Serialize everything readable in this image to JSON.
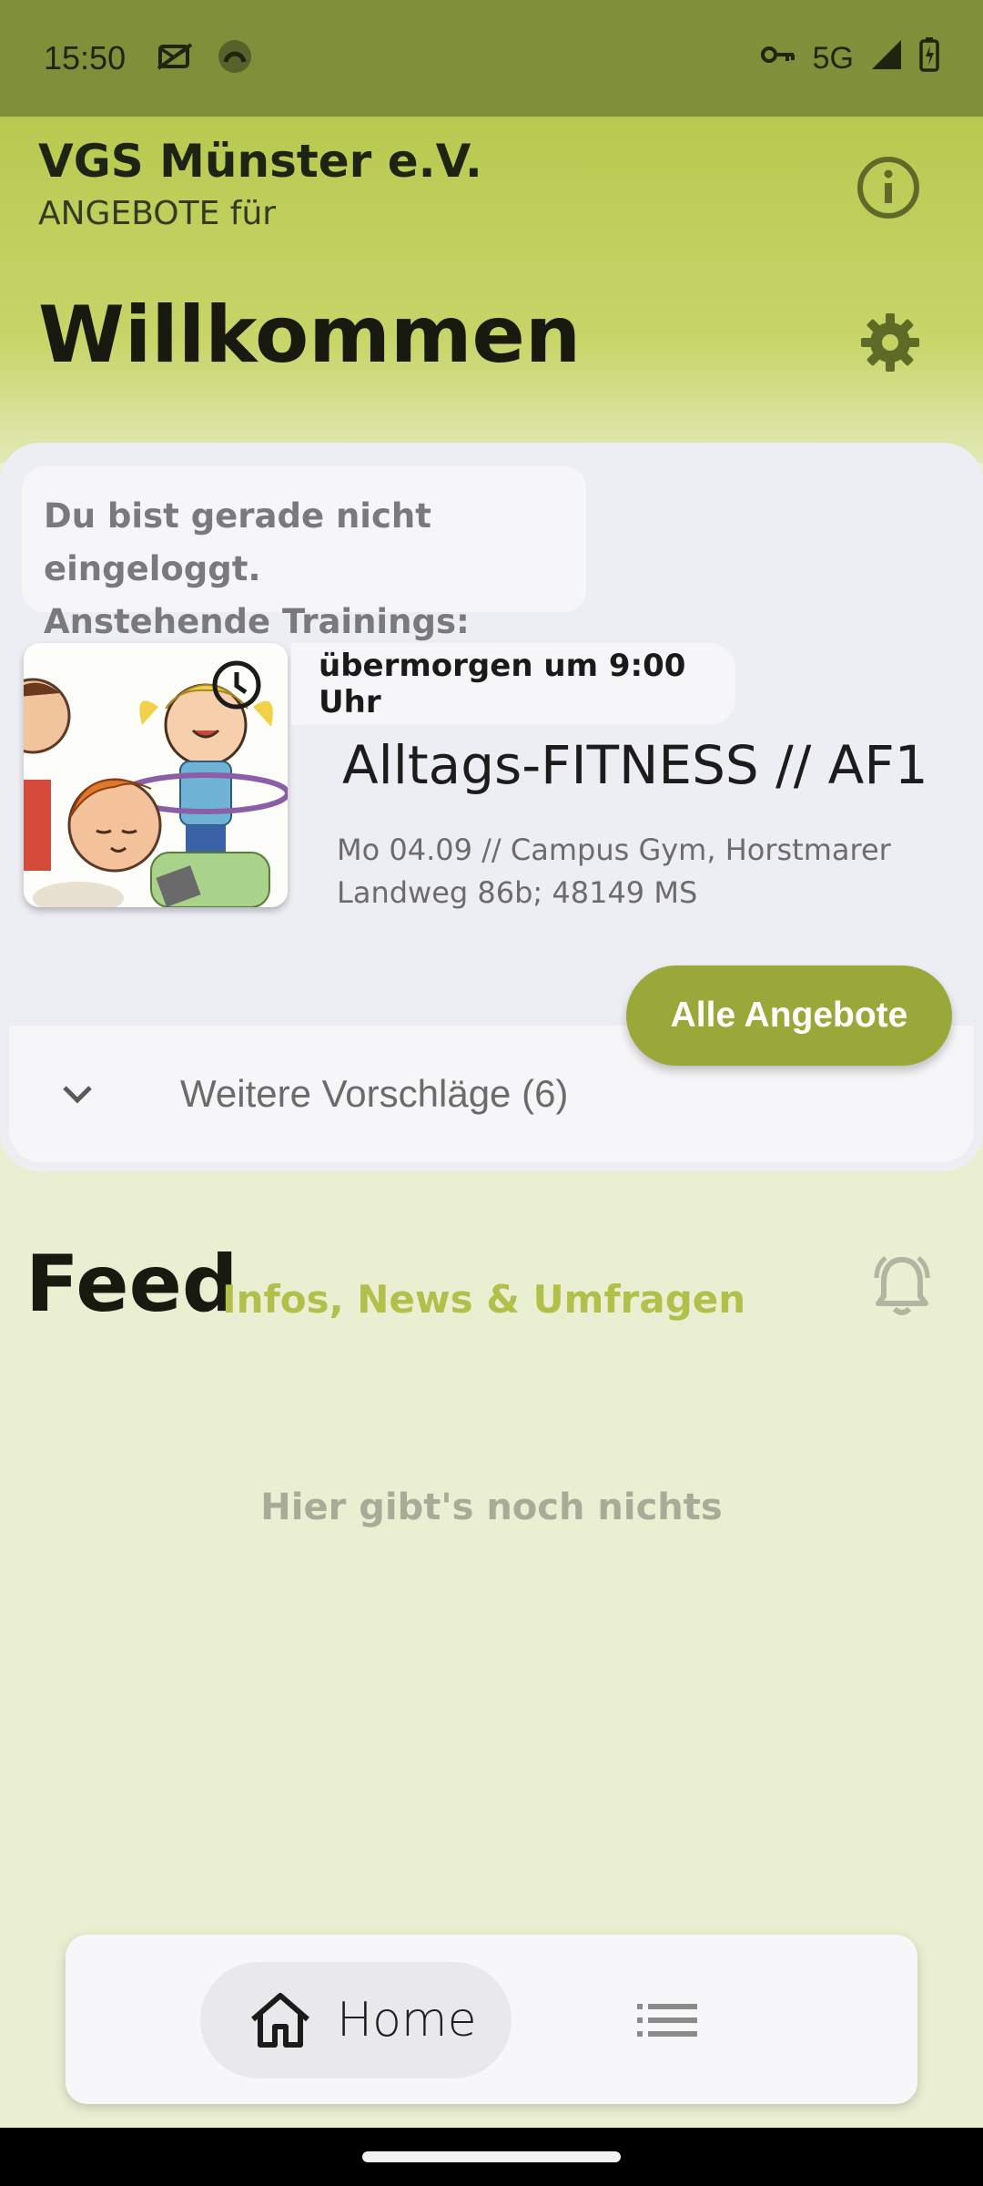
{
  "status_bar": {
    "time": "15:50",
    "network": "5G",
    "icons": [
      "mail-off-icon",
      "app-circle-icon",
      "vpn-key-icon",
      "signal-icon",
      "battery-icon"
    ]
  },
  "header": {
    "org_name": "VGS Münster e.V.",
    "subtitle": "ANGEBOTE für",
    "welcome": "Willkommen",
    "accent_color": "#b8c950"
  },
  "card": {
    "login_note_line1": "Du bist gerade nicht eingeloggt.",
    "login_note_line2": "Anstehende Trainings:",
    "training": {
      "when": "übermorgen um 9:00 Uhr",
      "title": "Alltags-FITNESS // AF1",
      "detail": "Mo 04.09 // Campus Gym, Horstmarer Landweg 86b; 48149 MS"
    },
    "all_offers_label": "Alle Angebote",
    "more_suggestions_label": "Weitere Vorschläge (6)"
  },
  "feed": {
    "title": "Feed",
    "subtitle": "Infos, News & Umfragen",
    "empty_text": "Hier gibt's noch nichts"
  },
  "bottom_nav": {
    "home_label": "Home"
  }
}
